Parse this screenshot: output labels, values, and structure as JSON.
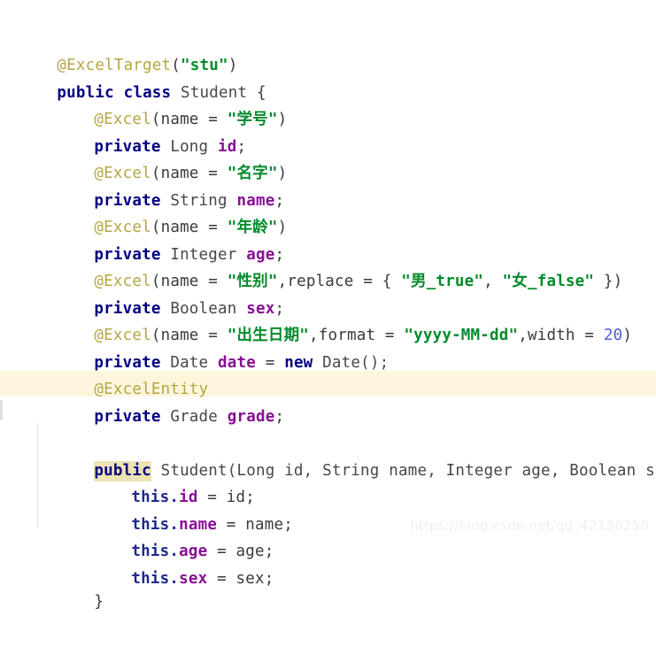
{
  "editor": {
    "language": "java",
    "background_color": "#ffffff",
    "highlight_band_color": "#fdf6dd",
    "match_highlight_color": "#ede3b4",
    "indent_guide_color": "#e3e3e3",
    "colors": {
      "keyword": "#000080",
      "type": "#484848",
      "field": "#871094",
      "annotation": "#b5a642",
      "string": "#038b2b",
      "number": "#4a5fd6",
      "punctuation": "#3a3a3a"
    }
  },
  "code": {
    "line_01": {
      "anno": "@ExcelTarget",
      "open": "(",
      "str": "\"stu\"",
      "close": ")"
    },
    "line_02": {
      "kw_public": "public",
      "kw_class": "class",
      "name": "Student",
      "brace": "{"
    },
    "line_03": {
      "anno": "@Excel",
      "open": "(",
      "attr": "name = ",
      "str": "\"学号\"",
      "close": ")"
    },
    "line_04": {
      "kw": "private",
      "type": "Long",
      "field": "id",
      "semi": ";"
    },
    "line_05": {
      "anno": "@Excel",
      "open": "(",
      "attr": "name = ",
      "str": "\"名字\"",
      "close": ")"
    },
    "line_06": {
      "kw": "private",
      "type": "String",
      "field": "name",
      "semi": ";"
    },
    "line_07": {
      "anno": "@Excel",
      "open": "(",
      "attr": "name = ",
      "str": "\"年龄\"",
      "close": ")"
    },
    "line_08": {
      "kw": "private",
      "type": "Integer",
      "field": "age",
      "semi": ";"
    },
    "line_09": {
      "anno": "@Excel",
      "open": "(",
      "attr1": "name = ",
      "str1": "\"性别\"",
      "attr2": ",replace = { ",
      "str2": "\"男_true\"",
      "comma": ", ",
      "str3": "\"女_false\"",
      "close": " })"
    },
    "line_10": {
      "kw": "private",
      "type": "Boolean",
      "field": "sex",
      "semi": ";"
    },
    "line_11": {
      "anno": "@Excel",
      "open": "(",
      "attr1": "name = ",
      "str1": "\"出生日期\"",
      "attr2": ",format = ",
      "str2": "\"yyyy-MM-dd\"",
      "attr3": ",width = ",
      "num": "20",
      "close": ")"
    },
    "line_12": {
      "kw": "private",
      "type": "Date",
      "field": "date",
      "eq": " = ",
      "kw_new": "new",
      "ctor": "Date();"
    },
    "line_13": {
      "anno": "@ExcelEntity"
    },
    "line_14": {
      "kw": "private",
      "type": "Grade",
      "field": "grade",
      "semi": ";"
    },
    "line_15": {
      "blank": ""
    },
    "line_16": {
      "kw_public": "public",
      "signature": "Student(Long id, String name, Integer age, Boolean sex) {"
    },
    "line_17": {
      "this": "this.",
      "field": "id",
      "rest": " = id;"
    },
    "line_18": {
      "this": "this.",
      "field": "name",
      "rest": " = name;"
    },
    "line_19": {
      "this": "this.",
      "field": "age",
      "rest": " = age;"
    },
    "line_20": {
      "this": "this.",
      "field": "sex",
      "rest": " = sex;"
    },
    "line_21": {
      "brace": "}"
    }
  },
  "watermark": {
    "text": "https://blog.csdn.net/qq_42136250"
  }
}
